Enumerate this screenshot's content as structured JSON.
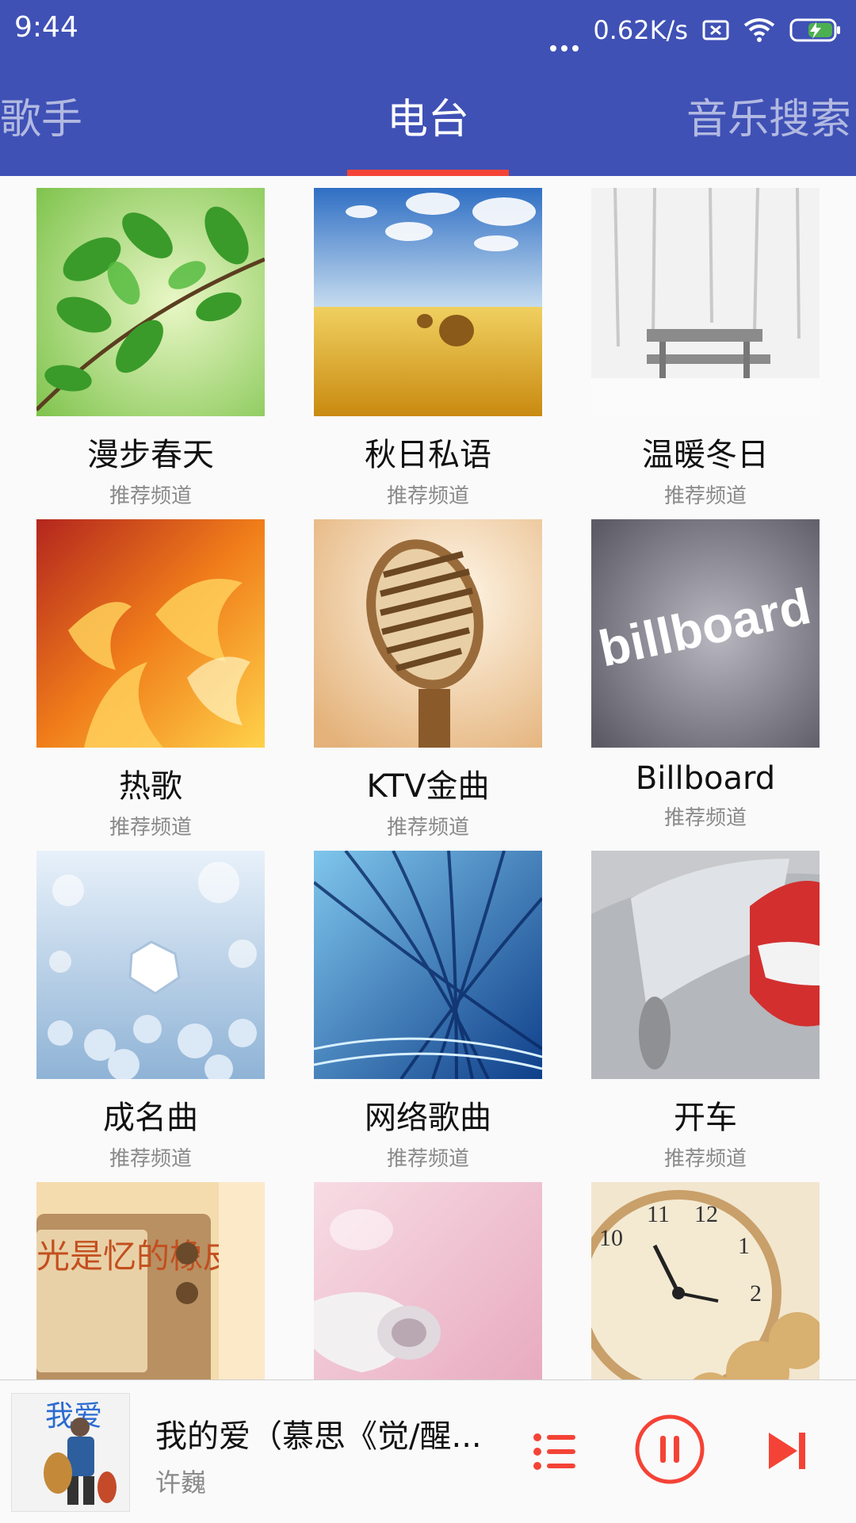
{
  "status_bar": {
    "time": "9:44",
    "network_speed": "0.62K/s",
    "icons": [
      "more-dots-icon",
      "sim-off-icon",
      "wifi-icon",
      "battery-charging-icon"
    ]
  },
  "tabs": [
    {
      "label": "歌手"
    },
    {
      "label": "电台"
    },
    {
      "label": "音乐搜索"
    }
  ],
  "active_tab": 1,
  "colors": {
    "primary": "#3f51b5",
    "accent": "#f44336",
    "indicator": "#f44336"
  },
  "channels": [
    {
      "title": "漫步春天",
      "subtitle": "推荐频道"
    },
    {
      "title": "秋日私语",
      "subtitle": "推荐频道"
    },
    {
      "title": "温暖冬日",
      "subtitle": "推荐频道"
    },
    {
      "title": "热歌",
      "subtitle": "推荐频道"
    },
    {
      "title": "KTV金曲",
      "subtitle": "推荐频道"
    },
    {
      "title": "Billboard",
      "subtitle": "推荐频道"
    },
    {
      "title": "成名曲",
      "subtitle": "推荐频道"
    },
    {
      "title": "网络歌曲",
      "subtitle": "推荐频道"
    },
    {
      "title": "开车",
      "subtitle": "推荐频道"
    },
    {
      "title": "",
      "subtitle": ""
    },
    {
      "title": "",
      "subtitle": ""
    },
    {
      "title": "",
      "subtitle": ""
    }
  ],
  "billboard_logo_text": "billboard",
  "retro_tv_text": "光是忆的橡皮",
  "player": {
    "song": "我的爱（慕思《觉/醒...",
    "artist": "许巍",
    "cover_text": "我爱",
    "icons": [
      "playlist-icon",
      "pause-icon",
      "skip-next-icon"
    ]
  }
}
